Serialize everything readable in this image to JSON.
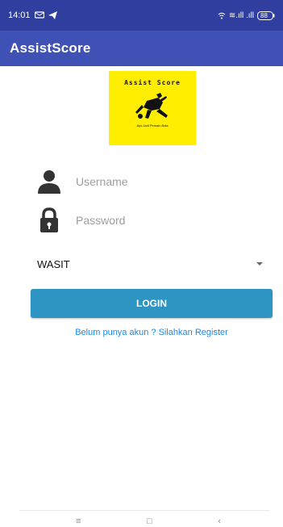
{
  "status_bar": {
    "time": "14:01",
    "signal_text": "≋.ıll .ıll",
    "battery_text": "88"
  },
  "app_bar": {
    "title": "AssistScore"
  },
  "logo": {
    "title": "Assist Score",
    "tagline": "Ayo Jadi Pemain Bola"
  },
  "form": {
    "username": {
      "value": "",
      "placeholder": "Username"
    },
    "password": {
      "value": "",
      "placeholder": "Password"
    },
    "role": {
      "selected": "WASIT"
    },
    "login_label": "LOGIN",
    "register_text": "Belum punya akun ? Silahkan Register"
  },
  "nav_bar": {
    "menu_glyph": "≡",
    "home_glyph": "□",
    "back_glyph": "‹"
  },
  "colors": {
    "status_bar": "#303f9f",
    "app_bar": "#3f51b5",
    "logo_background": "#ffee00",
    "login_button": "#2e94c2",
    "register_link": "#1e88e5"
  },
  "icons": {
    "status_left": [
      "message-icon",
      "send-icon"
    ],
    "status_right": [
      "wifi-icon",
      "signal-icon",
      "battery-icon"
    ],
    "username_field": "person-icon",
    "password_field": "lock-icon",
    "role_dropdown": "chevron-down-icon"
  }
}
